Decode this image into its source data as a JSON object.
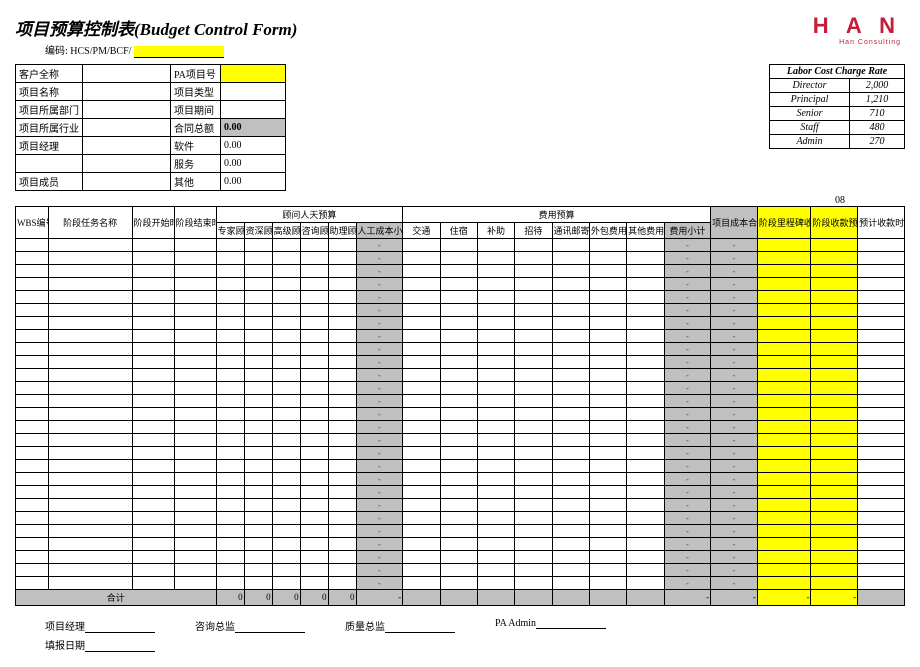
{
  "title": "项目预算控制表(Budget Control Form)",
  "code_prefix": "编码: HCS/PM/BCF/",
  "logo": {
    "text": "H A N",
    "sub": "Han Consulting"
  },
  "info_left": [
    {
      "l1": "客户全称",
      "v1": "",
      "l2": "PA项目号",
      "v2": "",
      "v2_yellow": true
    },
    {
      "l1": "项目名称",
      "v1": "",
      "l2": "项目类型",
      "v2": ""
    },
    {
      "l1": "项目所属部门",
      "v1": "",
      "l2": "项目期间",
      "v2": ""
    },
    {
      "l1": "项目所属行业",
      "v1": "",
      "l2": "合同总额",
      "v2": "0.00",
      "v2_grey": true
    },
    {
      "l1": "项目经理",
      "v1": "",
      "l2": "软件",
      "v2": "0.00"
    },
    {
      "l1": "",
      "v1": "",
      "l2": "服务",
      "v2": "0.00",
      "rowspan_start": true
    },
    {
      "l1": "项目成员",
      "v1": "",
      "l2": "其他",
      "v2": "0.00"
    }
  ],
  "rate_table": {
    "title": "Labor Cost Charge Rate",
    "rows": [
      {
        "label": "Director",
        "value": "2,000"
      },
      {
        "label": "Principal",
        "value": "1,210"
      },
      {
        "label": "Senior",
        "value": "710"
      },
      {
        "label": "Staff",
        "value": "480"
      },
      {
        "label": "Admin",
        "value": "270"
      }
    ]
  },
  "month_label": "08",
  "group_headers": {
    "labor": "顾问人天预算",
    "expense": "费用预算"
  },
  "columns": [
    "WBS编号",
    "阶段任务名称",
    "阶段开始时间",
    "阶段结束时间",
    "专家顾问",
    "资深顾问",
    "高级顾问",
    "咨询顾问",
    "助理顾问",
    "人工成本小计",
    "交通",
    "住宿",
    "补助",
    "招待",
    "通讯邮寄",
    "外包费用",
    "其他费用",
    "费用小计",
    "项目成本合计",
    "阶段里程碑收入预算",
    "阶段收款预算",
    "预计收款时间"
  ],
  "data_row_count": 27,
  "total_row": {
    "label": "合计",
    "values": [
      "0",
      "0",
      "0",
      "0",
      "0",
      "-",
      "",
      "",
      "",
      "",
      "",
      "",
      "",
      "-",
      "-",
      "-",
      "-",
      ""
    ]
  },
  "footer": {
    "pm": "项目经理",
    "date": "填报日期",
    "consult": "咨询总监",
    "quality": "质量总监",
    "pa": "PA Admin"
  }
}
